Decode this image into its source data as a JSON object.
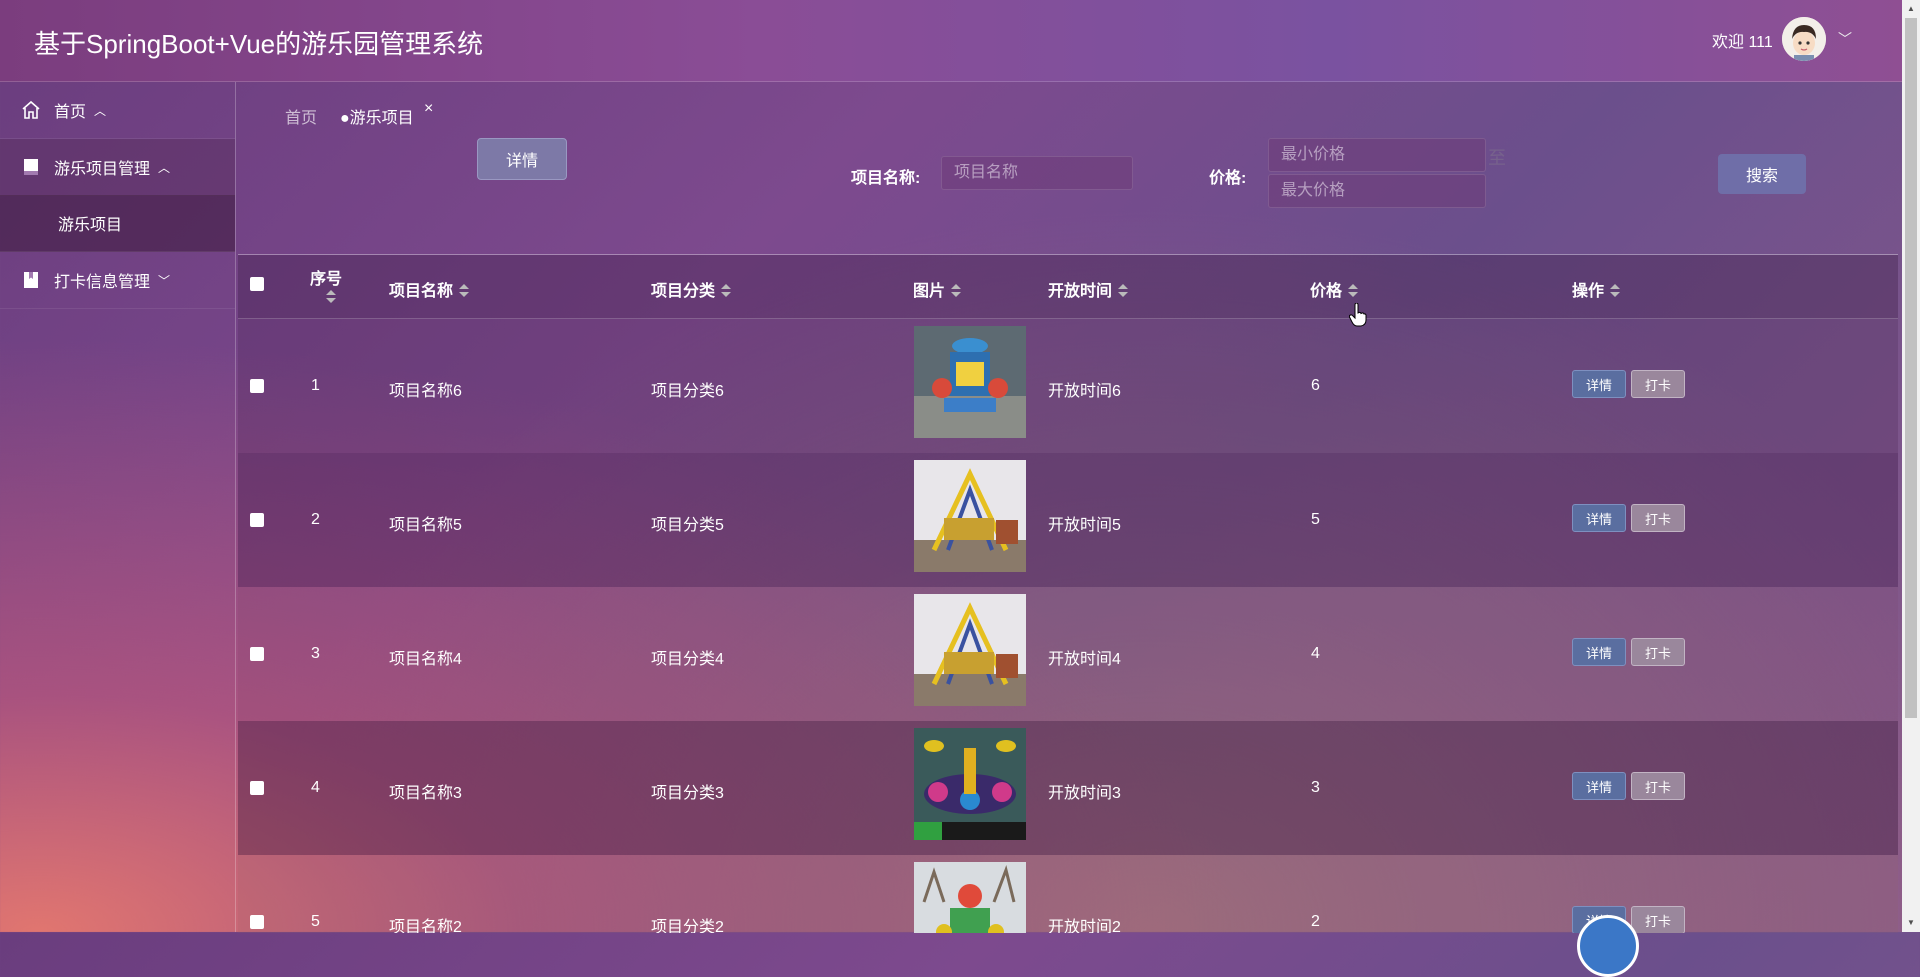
{
  "header": {
    "title": "基于SpringBoot+Vue的游乐园管理系统",
    "welcome": "欢迎 111"
  },
  "sidebar": {
    "items": [
      {
        "label": "首页",
        "icon": "home-icon"
      },
      {
        "label": "游乐项目管理",
        "icon": "bookmark-icon"
      },
      {
        "label": "游乐项目",
        "icon": ""
      },
      {
        "label": "打卡信息管理",
        "icon": "book-icon"
      }
    ]
  },
  "tabs": {
    "home": "首页",
    "active": "●游乐项目",
    "close": "×"
  },
  "toolbar": {
    "detail_label": "详情",
    "name_label": "项目名称:",
    "name_placeholder": "项目名称",
    "price_label": "价格:",
    "min_placeholder": "最小价格",
    "max_placeholder": "最大价格",
    "to_text": "至",
    "search_label": "搜索"
  },
  "table": {
    "columns": [
      "序号",
      "项目名称",
      "项目分类",
      "图片",
      "开放时间",
      "价格",
      "操作"
    ],
    "rows": [
      {
        "index": "1",
        "name": "项目名称6",
        "category": "项目分类6",
        "open_time": "开放时间6",
        "price": "6"
      },
      {
        "index": "2",
        "name": "项目名称5",
        "category": "项目分类5",
        "open_time": "开放时间5",
        "price": "5"
      },
      {
        "index": "3",
        "name": "项目名称4",
        "category": "项目分类4",
        "open_time": "开放时间4",
        "price": "4"
      },
      {
        "index": "4",
        "name": "项目名称3",
        "category": "项目分类3",
        "open_time": "开放时间3",
        "price": "3"
      },
      {
        "index": "5",
        "name": "项目名称2",
        "category": "项目分类2",
        "open_time": "开放时间2",
        "price": "2"
      }
    ],
    "action_detail": "详情",
    "action_punch": "打卡"
  }
}
